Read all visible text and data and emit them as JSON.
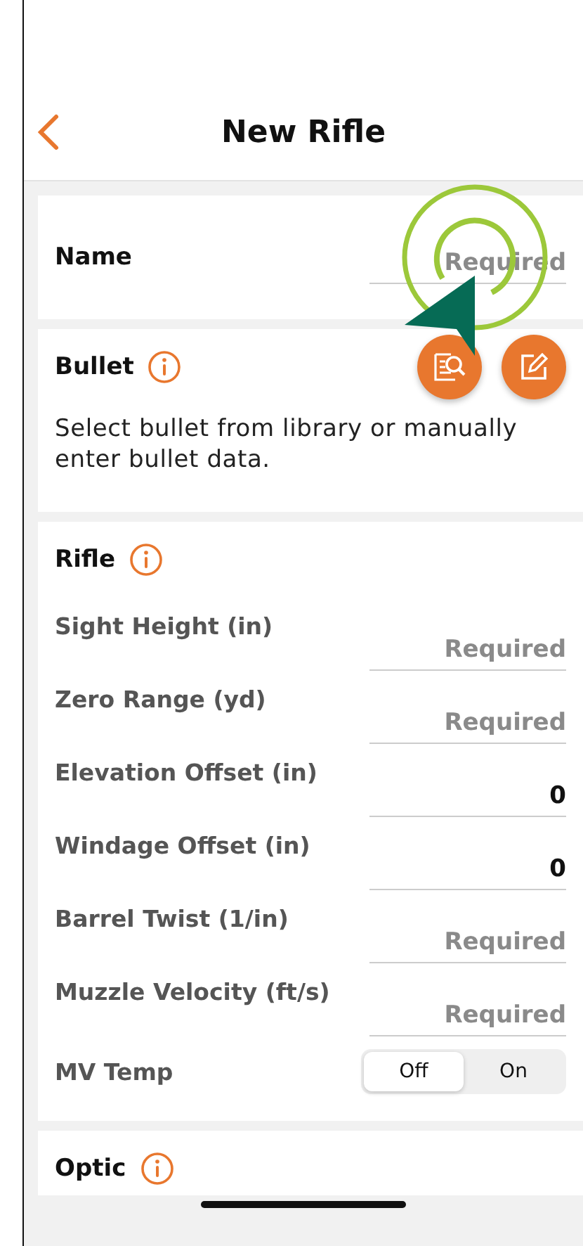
{
  "nav": {
    "title": "New Rifle"
  },
  "name_field": {
    "label": "Name",
    "placeholder": "Required"
  },
  "bullet": {
    "title": "Bullet",
    "description": "Select bullet from library or manually enter bullet data."
  },
  "rifle": {
    "title": "Rifle",
    "rows": [
      {
        "kind": "field",
        "label": "Sight Height (in)",
        "placeholder": "Required"
      },
      {
        "kind": "field",
        "label": "Zero Range (yd)",
        "placeholder": "Required"
      },
      {
        "kind": "field",
        "label": "Elevation Offset (in)",
        "value": "0"
      },
      {
        "kind": "field",
        "label": "Windage Offset (in)",
        "value": "0"
      },
      {
        "kind": "field",
        "label": "Barrel Twist (1/in)",
        "placeholder": "Required"
      },
      {
        "kind": "field",
        "label": "Muzzle Velocity (ft/s)",
        "placeholder": "Required"
      },
      {
        "kind": "segmented",
        "label": "MV Temp",
        "options": [
          {
            "label": "Off",
            "selected": true
          },
          {
            "label": "On",
            "selected": false
          }
        ]
      }
    ]
  },
  "optic": {
    "title": "Optic"
  }
}
